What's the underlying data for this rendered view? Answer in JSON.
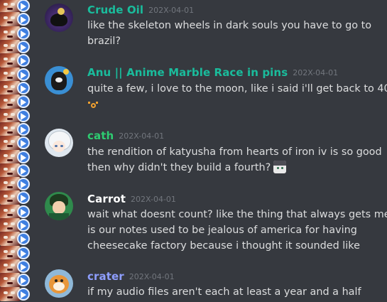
{
  "colors": {
    "background": "#36393f",
    "text": "#dcddde",
    "timestamp": "#72767d"
  },
  "emote_strip": {
    "icon": "emote-face-with-arrow-icon",
    "count": 22
  },
  "messages": [
    {
      "username": "Crude Oil",
      "username_color": "#1abc9c",
      "timestamp": "202X-04-01",
      "avatar_icon": "skeleton-avatar-icon",
      "lines": [
        "like the skeleton wheels in dark souls you have to go to",
        "brazil?"
      ]
    },
    {
      "username": "Anu || Anime Marble Race in pins",
      "username_color": "#1abc9c",
      "timestamp": "202X-04-01",
      "avatar_icon": "black-cat-avatar-icon",
      "lines": [
        "quite a few, i love to the moon, like i said i'll get back to 40"
      ],
      "trailing_emoji": "mouth-o-emoji-icon"
    },
    {
      "username": "cath",
      "username_color": "#2ecc71",
      "timestamp": "202X-04-01",
      "avatar_icon": "white-haired-avatar-icon",
      "lines": [
        "the rendition of katyusha from hearts of iron iv is so good",
        "then why didn't they build a fourth?"
      ],
      "inline_emoji": "anime-face-emoji-icon"
    },
    {
      "username": "Carrot",
      "username_color": "#ffffff",
      "timestamp": "202X-04-01",
      "avatar_icon": "green-hair-avatar-icon",
      "lines": [
        "wait what doesnt count? like the thing that always gets me",
        "is our notes used to be jealous of america for having",
        "cheesecake factory because i thought it sounded like"
      ]
    },
    {
      "username": "crater",
      "username_color": "#8e9eff",
      "timestamp": "202X-04-01",
      "avatar_icon": "tiger-avatar-icon",
      "lines": [
        "if my audio files aren't each at least a year and a half"
      ]
    }
  ]
}
